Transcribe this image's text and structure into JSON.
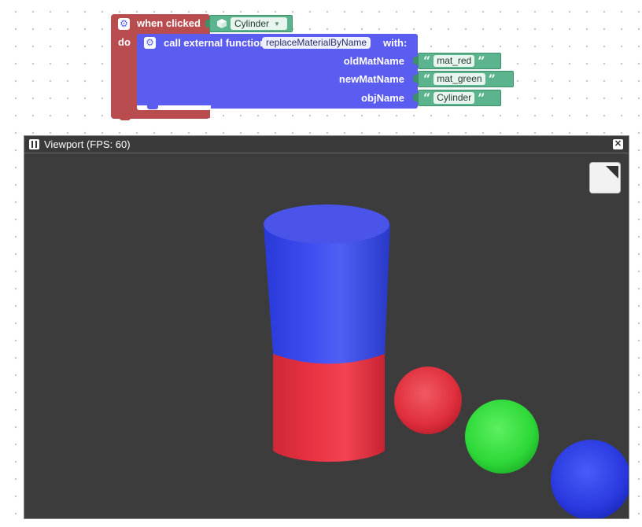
{
  "event_block": {
    "label": "when clicked",
    "do_label": "do",
    "object_name": "Cylinder",
    "colors": {
      "event": "#b84c4f",
      "object": "#5bb48e"
    }
  },
  "call_block": {
    "prefix": "call external function",
    "function_name": "replaceMaterialByName",
    "suffix": "with:",
    "color": "#5b5cf0",
    "args": [
      {
        "name": "oldMatName",
        "value": "mat_red"
      },
      {
        "name": "newMatName",
        "value": "mat_green"
      },
      {
        "name": "objName",
        "value": "Cylinder"
      }
    ]
  },
  "viewport": {
    "title": "Viewport (FPS: 60)",
    "close_icon": "close-icon",
    "pause_icon": "pause-icon",
    "toggle_icon": "fullscreen-toggle-icon",
    "background": "#3c3c3c"
  }
}
